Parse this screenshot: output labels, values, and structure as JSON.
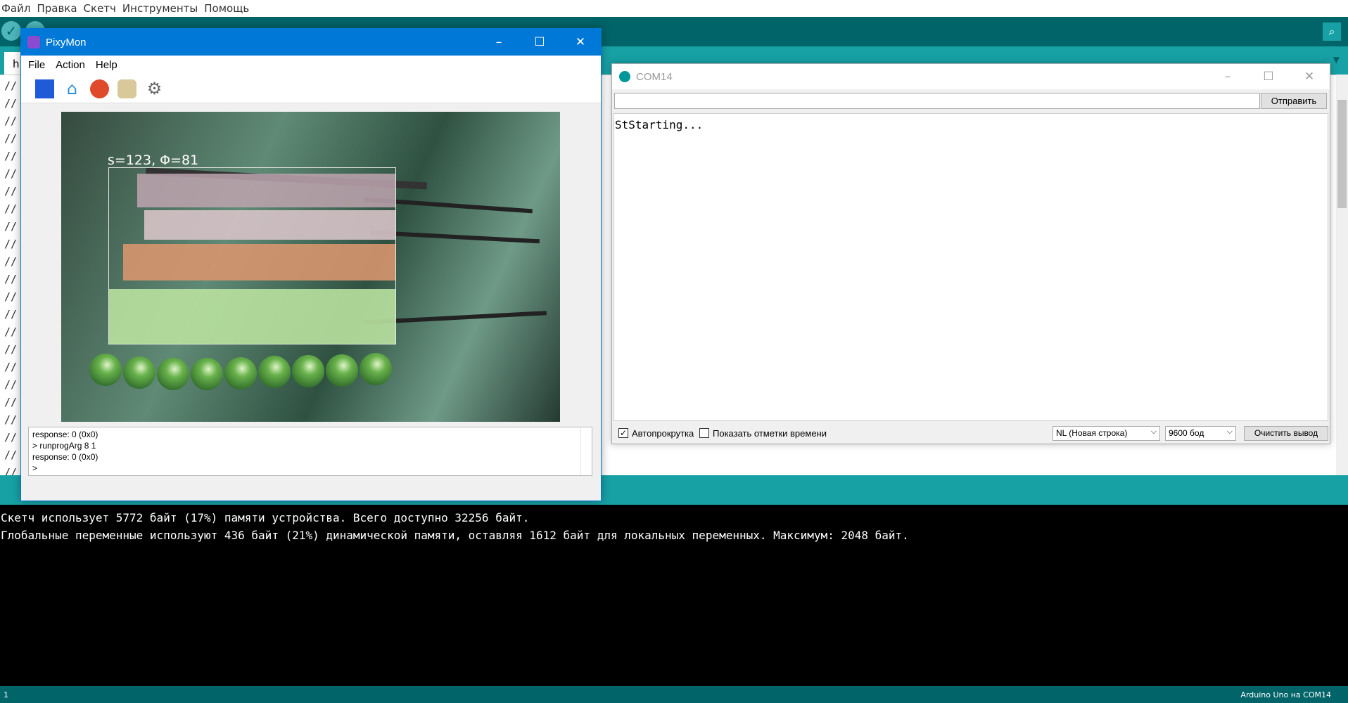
{
  "arduino": {
    "menu": [
      "Файл",
      "Правка",
      "Скетч",
      "Инструменты",
      "Помощь"
    ],
    "tab_label": "h",
    "console_lines": [
      "Скетч использует 5772 байт (17%) памяти устройства. Всего доступно 32256 байт.",
      "Глобальные переменные используют 436 байт (21%) динамической памяти, оставляя 1612 байт для локальных переменных. Максимум: 2048 байт."
    ],
    "status_left": "1",
    "status_right": "Arduino Uno на COM14",
    "editor_comment": "//",
    "colors": {
      "toolbar": "#006468",
      "tabbar": "#17a1a5",
      "console_bg": "#000000"
    }
  },
  "pixymon": {
    "title": "PixyMon",
    "menu": [
      "File",
      "Action",
      "Help"
    ],
    "tools": [
      "stop-icon",
      "home-icon",
      "signature-icon",
      "helper-icon",
      "gear-icon"
    ],
    "block_label": "s=123, Φ=81",
    "log_lines": [
      "response: 0 (0x0)",
      "> runprogArg 8 1",
      "response: 0 (0x0)",
      ">"
    ]
  },
  "serial": {
    "title": "COM14",
    "send_label": "Отправить",
    "output": "StStarting...",
    "autoscroll_label": "Автопрокрутка",
    "autoscroll_checked": true,
    "timestamps_label": "Показать отметки времени",
    "timestamps_checked": false,
    "line_ending": "NL (Новая строка)",
    "baud": "9600 бод",
    "clear_label": "Очистить вывод"
  }
}
